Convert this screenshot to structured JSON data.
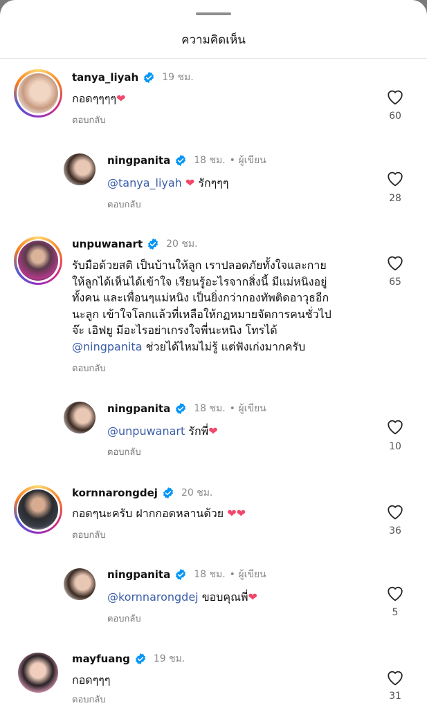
{
  "header": {
    "title": "ความคิดเห็น"
  },
  "colors": {
    "mention": "#3b5da8",
    "muted": "#8a8a8a",
    "verified": "#0095f6",
    "heart": "#f2476b"
  },
  "comments": [
    {
      "username": "tanya_liyah",
      "time": "19 ชม.",
      "author_tag": "",
      "text": "กอดๆๆๆๆ",
      "emoji": "❤",
      "mention": "",
      "reply_label": "ตอบกลับ",
      "likes": "60",
      "reply": false
    },
    {
      "username": "ningpanita",
      "time": "18 ชม.",
      "author_tag": "• ผู้เขียน",
      "mention": "@tanya_liyah",
      "text": " รักๆๆๆ",
      "emoji_before": "❤",
      "reply_label": "ตอบกลับ",
      "likes": "28",
      "reply": true
    },
    {
      "username": "unpuwanart",
      "time": "20 ชม.",
      "author_tag": "",
      "lines": [
        "รับมือด้วยสติ  เป็นบ้านให้ลูก  เราปลอดภัยทั้งใจและกาย",
        "ให้ลูกได้เห็นได้เข้าใจ  เรียนรู้อะไรจากสิ่งนี้  มีแม่หนิงอยู่",
        "ทั้งคน  และเพื่อนๆแม่หนิง  เป็นยิ่งกว่ากองทัพติดอาวุธอีก",
        "นะลูก  เข้าใจโลกแล้วที่เหลือให้กฏหมายจัดการคนชั่วไป",
        "จ๊ะ เอิฟยู  มีอะไรอย่าเกรงใจพี่นะหนิง  โทรได้"
      ],
      "mention": "@ningpanita",
      "tail": " ช่วยได้ไหมไม่รู้ แต่ฟังเก่งมากครับ",
      "reply_label": "ตอบกลับ",
      "likes": "65",
      "reply": false
    },
    {
      "username": "ningpanita",
      "time": "18 ชม.",
      "author_tag": "• ผู้เขียน",
      "mention": "@unpuwanart",
      "text": " รักพี่",
      "emoji": "❤",
      "reply_label": "ตอบกลับ",
      "likes": "10",
      "reply": true
    },
    {
      "username": "kornnarongdej",
      "time": "20 ชม.",
      "author_tag": "",
      "text": "กอดๆนะครับ ฝากกอดหลานด้วย ",
      "emoji": "❤❤",
      "mention": "",
      "reply_label": "ตอบกลับ",
      "likes": "36",
      "reply": false
    },
    {
      "username": "ningpanita",
      "time": "18 ชม.",
      "author_tag": "• ผู้เขียน",
      "mention": "@kornnarongdej",
      "text": " ขอบคุณพี่",
      "emoji": "❤",
      "reply_label": "ตอบกลับ",
      "likes": "5",
      "reply": true
    },
    {
      "username": "mayfuang",
      "time": "19 ชม.",
      "author_tag": "",
      "text": "กอดๆๆๆ",
      "mention": "",
      "reply_label": "ตอบกลับ",
      "likes": "31",
      "reply": false
    }
  ]
}
